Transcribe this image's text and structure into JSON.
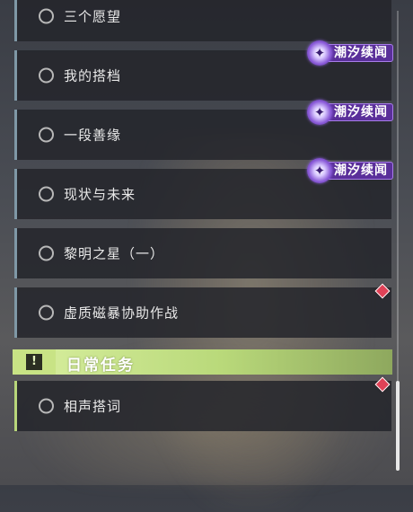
{
  "quests": [
    {
      "label": "三个愿望",
      "badge": false,
      "new_dot": false
    },
    {
      "label": "我的搭档",
      "badge": true,
      "new_dot": false
    },
    {
      "label": "一段善缘",
      "badge": true,
      "new_dot": false
    },
    {
      "label": "现状与未来",
      "badge": true,
      "new_dot": false
    },
    {
      "label": "黎明之星（一）",
      "badge": false,
      "new_dot": false
    },
    {
      "label": "虚质磁暴协助作战",
      "badge": false,
      "new_dot": true
    }
  ],
  "badge": {
    "text": "潮汐续闻",
    "icon": "tide-feather-icon"
  },
  "daily_section": {
    "title": "日常任务",
    "icon": "exclamation-box-icon",
    "quests": [
      {
        "label": "相声搭词",
        "new_dot": true
      }
    ]
  },
  "colors": {
    "accent_blue_bar": "#7f98a6",
    "accent_green": "#b8d67a",
    "badge_purple": "#5a2f9a",
    "new_dot_red": "#e04257"
  },
  "scroll": {
    "position_fraction": 0.95
  }
}
